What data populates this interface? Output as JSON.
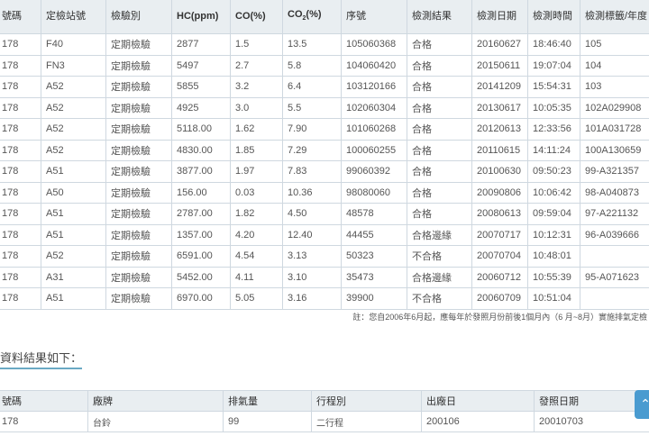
{
  "inspection_table": {
    "headers": [
      "號碼",
      "定檢站號",
      "檢驗別",
      "HC(ppm)",
      "CO(%)",
      "CO",
      "(%)",
      "序號",
      "檢測結果",
      "檢測日期",
      "檢測時間",
      "檢測標籤/年度"
    ],
    "co2_sub": "2",
    "rows": [
      [
        "178",
        "F40",
        "定期檢驗",
        "2877",
        "1.5",
        "13.5",
        "105060368",
        "合格",
        "20160627",
        "18:46:40",
        "105"
      ],
      [
        "178",
        "FN3",
        "定期檢驗",
        "5497",
        "2.7",
        "5.8",
        "104060420",
        "合格",
        "20150611",
        "19:07:04",
        "104"
      ],
      [
        "178",
        "A52",
        "定期檢驗",
        "5855",
        "3.2",
        "6.4",
        "103120166",
        "合格",
        "20141209",
        "15:54:31",
        "103"
      ],
      [
        "178",
        "A52",
        "定期檢驗",
        "4925",
        "3.0",
        "5.5",
        "102060304",
        "合格",
        "20130617",
        "10:05:35",
        "102A029908"
      ],
      [
        "178",
        "A52",
        "定期檢驗",
        "5118.00",
        "1.62",
        "7.90",
        "101060268",
        "合格",
        "20120613",
        "12:33:56",
        "101A031728"
      ],
      [
        "178",
        "A52",
        "定期檢驗",
        "4830.00",
        "1.85",
        "7.29",
        "100060255",
        "合格",
        "20110615",
        "14:11:24",
        "100A130659"
      ],
      [
        "178",
        "A51",
        "定期檢驗",
        "3877.00",
        "1.97",
        "7.83",
        "99060392",
        "合格",
        "20100630",
        "09:50:23",
        "99-A321357"
      ],
      [
        "178",
        "A50",
        "定期檢驗",
        "156.00",
        "0.03",
        "10.36",
        "98080060",
        "合格",
        "20090806",
        "10:06:42",
        "98-A040873"
      ],
      [
        "178",
        "A51",
        "定期檢驗",
        "2787.00",
        "1.82",
        "4.50",
        "48578",
        "合格",
        "20080613",
        "09:59:04",
        "97-A221132"
      ],
      [
        "178",
        "A51",
        "定期檢驗",
        "1357.00",
        "4.20",
        "12.40",
        "44455",
        "合格邊緣",
        "20070717",
        "10:12:31",
        "96-A039666"
      ],
      [
        "178",
        "A52",
        "定期檢驗",
        "6591.00",
        "4.54",
        "3.13",
        "50323",
        "不合格",
        "20070704",
        "10:48:01",
        ""
      ],
      [
        "178",
        "A31",
        "定期檢驗",
        "5452.00",
        "4.11",
        "3.10",
        "35473",
        "合格邊緣",
        "20060712",
        "10:55:39",
        "95-A071623"
      ],
      [
        "178",
        "A51",
        "定期檢驗",
        "6970.00",
        "5.05",
        "3.16",
        "39900",
        "不合格",
        "20060709",
        "10:51:04",
        ""
      ]
    ]
  },
  "note": "註：您自2006年6月起，應每年於發照月份前後1個月內（6 月~8月）實施排氣定檢",
  "section_title": "資料結果如下：",
  "vehicle_table": {
    "headers": [
      "號碼",
      "廠牌",
      "排氣量",
      "行程別",
      "出廠日",
      "發照日期"
    ],
    "rows": [
      [
        "178",
        "台鈴",
        "99",
        "二行程",
        "200106",
        "20010703"
      ]
    ]
  },
  "scroll_top_icon": "chevron-up-icon"
}
